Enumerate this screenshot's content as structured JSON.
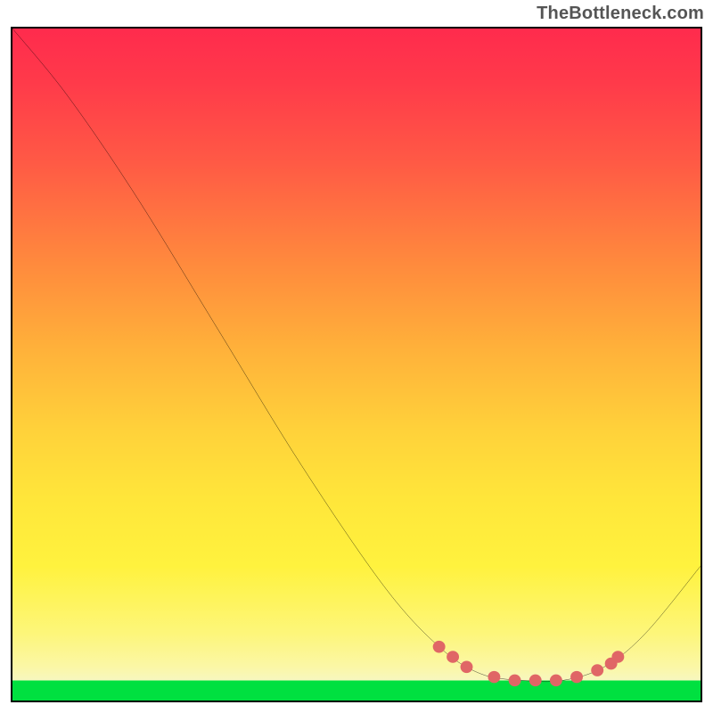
{
  "attribution": "TheBottleneck.com",
  "chart_data": {
    "type": "line",
    "title": "",
    "xlabel": "",
    "ylabel": "",
    "xlim": [
      0,
      100
    ],
    "ylim": [
      0,
      100
    ],
    "grid": false,
    "curve_points": [
      {
        "x": 0,
        "y": 0
      },
      {
        "x": 8,
        "y": 10
      },
      {
        "x": 18,
        "y": 25
      },
      {
        "x": 30,
        "y": 45
      },
      {
        "x": 42,
        "y": 65
      },
      {
        "x": 54,
        "y": 83
      },
      {
        "x": 62,
        "y": 92
      },
      {
        "x": 68,
        "y": 96
      },
      {
        "x": 74,
        "y": 97
      },
      {
        "x": 80,
        "y": 97
      },
      {
        "x": 86,
        "y": 95
      },
      {
        "x": 92,
        "y": 90
      },
      {
        "x": 100,
        "y": 80
      }
    ],
    "marker_points": [
      {
        "x": 62,
        "y": 92
      },
      {
        "x": 64,
        "y": 93.5
      },
      {
        "x": 66,
        "y": 95
      },
      {
        "x": 70,
        "y": 96.5
      },
      {
        "x": 73,
        "y": 97
      },
      {
        "x": 76,
        "y": 97
      },
      {
        "x": 79,
        "y": 97
      },
      {
        "x": 82,
        "y": 96.5
      },
      {
        "x": 85,
        "y": 95.5
      },
      {
        "x": 87,
        "y": 94.5
      },
      {
        "x": 88,
        "y": 93.5
      }
    ],
    "background_gradient": {
      "type": "vertical",
      "stops": [
        {
          "pos": 0.0,
          "color": "#ff2b4d"
        },
        {
          "pos": 0.35,
          "color": "#ff8a3d"
        },
        {
          "pos": 0.7,
          "color": "#ffe63a"
        },
        {
          "pos": 0.96,
          "color": "#f7f7bf"
        },
        {
          "pos": 0.97,
          "color": "#00e040"
        },
        {
          "pos": 1.0,
          "color": "#00e040"
        }
      ]
    },
    "curve_color": "#000000",
    "marker_color": "#e06666"
  }
}
